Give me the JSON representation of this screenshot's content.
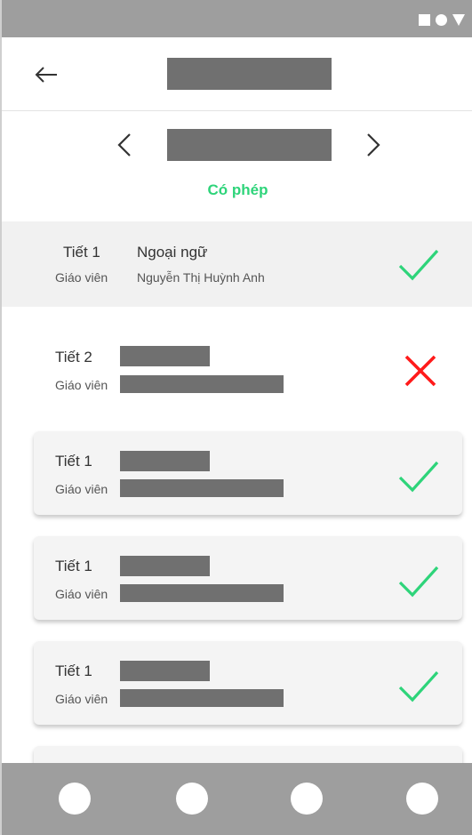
{
  "app_bar": {
    "back_icon": "arrow-left-icon",
    "title": ""
  },
  "date_nav": {
    "prev_icon": "chevron-left-icon",
    "next_icon": "chevron-right-icon",
    "date": ""
  },
  "status_filter": {
    "label": "Có phép",
    "color": "#2ed47a"
  },
  "lessons": [
    {
      "period": "Tiết 1",
      "subject": "Ngoại ngữ",
      "teacher_label": "Giáo viên",
      "teacher": "Nguyễn Thị Huỳnh Anh",
      "status": "present",
      "status_icon": "check-icon"
    },
    {
      "period": "Tiết 2",
      "subject": "",
      "teacher_label": "Giáo viên",
      "teacher": "",
      "status": "absent",
      "status_icon": "cross-icon"
    },
    {
      "period": "Tiết 1",
      "subject": "",
      "teacher_label": "Giáo viên",
      "teacher": "",
      "status": "present",
      "status_icon": "check-icon"
    },
    {
      "period": "Tiết 1",
      "subject": "",
      "teacher_label": "Giáo viên",
      "teacher": "",
      "status": "present",
      "status_icon": "check-icon"
    },
    {
      "period": "Tiết 1",
      "subject": "",
      "teacher_label": "Giáo viên",
      "teacher": "",
      "status": "present",
      "status_icon": "check-icon"
    }
  ],
  "colors": {
    "check": "#2ed47a",
    "cross": "#ff1a1a",
    "status_bar": "#9e9e9e",
    "bottom_nav": "#9e9e9e",
    "placeholder": "#707070"
  },
  "bottom_nav": [
    "nav-item-1",
    "nav-item-2",
    "nav-item-3",
    "nav-item-4"
  ]
}
